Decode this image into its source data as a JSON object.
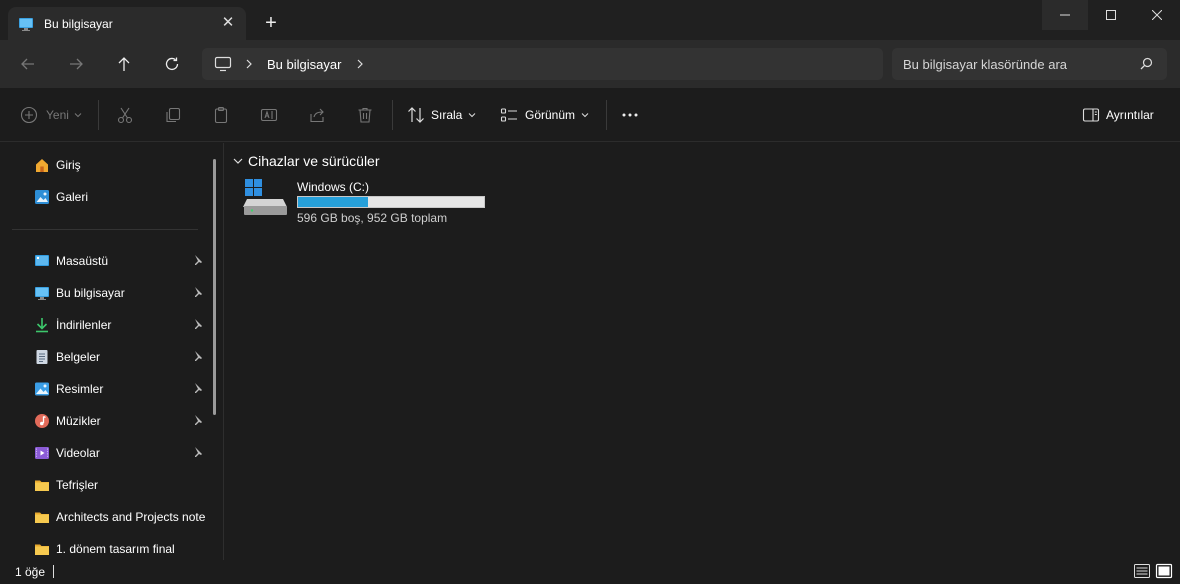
{
  "window": {
    "tab_title": "Bu bilgisayar",
    "tab_icon": "monitor-icon",
    "new_tab_symbol": "+",
    "close_symbol": "✕"
  },
  "address": {
    "crumb": "Bu bilgisayar",
    "search_placeholder": "Bu bilgisayar klasöründe ara"
  },
  "toolbar": {
    "new_label": "Yeni",
    "sort_label": "Sırala",
    "view_label": "Görünüm",
    "details_label": "Ayrıntılar"
  },
  "sidebar": {
    "items": [
      {
        "label": "Giriş",
        "icon": "home-icon"
      },
      {
        "label": "Galeri",
        "icon": "gallery-icon"
      },
      {
        "label": "Masaüstü",
        "icon": "desktop-icon",
        "pinned": true
      },
      {
        "label": "Bu bilgisayar",
        "icon": "monitor-icon",
        "pinned": true
      },
      {
        "label": "İndirilenler",
        "icon": "download-icon",
        "pinned": true
      },
      {
        "label": "Belgeler",
        "icon": "document-icon",
        "pinned": true
      },
      {
        "label": "Resimler",
        "icon": "pictures-icon",
        "pinned": true
      },
      {
        "label": "Müzikler",
        "icon": "music-icon",
        "pinned": true
      },
      {
        "label": "Videolar",
        "icon": "video-icon",
        "pinned": true
      },
      {
        "label": "Tefrişler",
        "icon": "folder-icon"
      },
      {
        "label": "Architects and Projects note",
        "icon": "folder-icon"
      },
      {
        "label": "1. dönem tasarım final",
        "icon": "folder-icon"
      }
    ]
  },
  "main": {
    "section_title": "Cihazlar ve sürücüler",
    "drives": [
      {
        "name": "Windows (C:)",
        "info": "596 GB boş, 952 GB toplam",
        "used_fraction": 0.374
      }
    ]
  },
  "status": {
    "item_count": "1 öğe"
  },
  "colors": {
    "accent": "#26a0da",
    "background": "#1c1c1c",
    "surface": "#2b2b2b",
    "folder": "#f3c34f"
  }
}
